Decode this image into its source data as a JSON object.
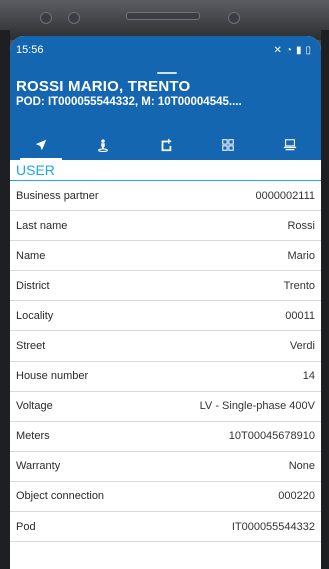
{
  "status_bar": {
    "time": "15:56"
  },
  "header": {
    "title": "ROSSI MARIO, TRENTO",
    "subtitle": "POD: IT000055544332, M: 10T00004545...."
  },
  "tabs": [
    {
      "icon": "navigation-arrow-icon"
    },
    {
      "icon": "person-pin-icon"
    },
    {
      "icon": "document-add-icon"
    },
    {
      "icon": "qr-grid-icon"
    },
    {
      "icon": "scanner-icon"
    }
  ],
  "section": {
    "title": "USER"
  },
  "fields": [
    {
      "label": "Business partner",
      "value": "0000002111"
    },
    {
      "label": "Last name",
      "value": "Rossi"
    },
    {
      "label": "Name",
      "value": "Mario"
    },
    {
      "label": "District",
      "value": "Trento"
    },
    {
      "label": "Locality",
      "value": "00011"
    },
    {
      "label": "Street",
      "value": "Verdi"
    },
    {
      "label": "House number",
      "value": "14"
    },
    {
      "label": "Voltage",
      "value": "LV - Single-phase 400V"
    },
    {
      "label": "Meters",
      "value": "10T00045678910"
    },
    {
      "label": "Warranty",
      "value": "None"
    },
    {
      "label": "Object connection",
      "value": "000220"
    },
    {
      "label": "Pod",
      "value": "IT000055544332"
    }
  ],
  "colors": {
    "primary": "#1566b0",
    "accent": "#1aa8e8"
  }
}
